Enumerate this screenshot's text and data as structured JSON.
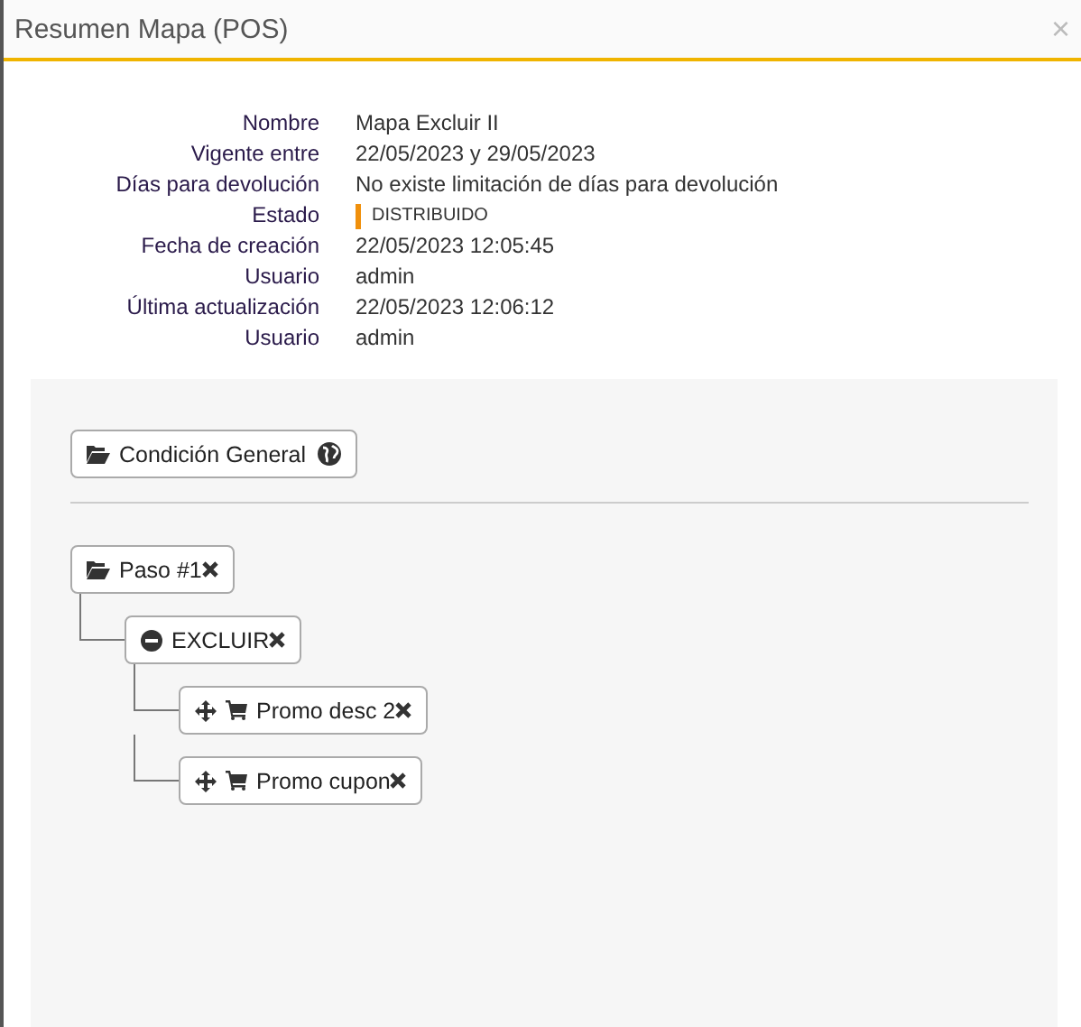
{
  "window": {
    "title": "Resumen Mapa (POS)",
    "close": "×"
  },
  "details": [
    {
      "label": "Nombre",
      "value": "Mapa Excluir II"
    },
    {
      "label": "Vigente entre",
      "value": "22/05/2023 y 29/05/2023"
    },
    {
      "label": "Días para devolución",
      "value": "No existe limitación de días para devolución"
    },
    {
      "label": "Estado",
      "value": "DISTRIBUIDO",
      "kind": "status",
      "color": "#f0900c"
    },
    {
      "label": "Fecha de creación",
      "value": "22/05/2023 12:05:45"
    },
    {
      "label": "Usuario",
      "value": "admin"
    },
    {
      "label": "Última actualización",
      "value": "22/05/2023 12:06:12"
    },
    {
      "label": "Usuario",
      "value": "admin"
    }
  ],
  "general_condition": {
    "label": "Condición General",
    "kind": "folder",
    "global": true
  },
  "tree": [
    {
      "label": "Paso #1",
      "kind": "folder",
      "removable": true,
      "children": [
        {
          "label": "EXCLUIR",
          "kind": "exclude",
          "removable": true,
          "children": [
            {
              "label": "Promo desc 2",
              "kind": "product",
              "removable": true
            },
            {
              "label": "Promo cupon",
              "kind": "product",
              "removable": true
            }
          ]
        }
      ]
    }
  ]
}
